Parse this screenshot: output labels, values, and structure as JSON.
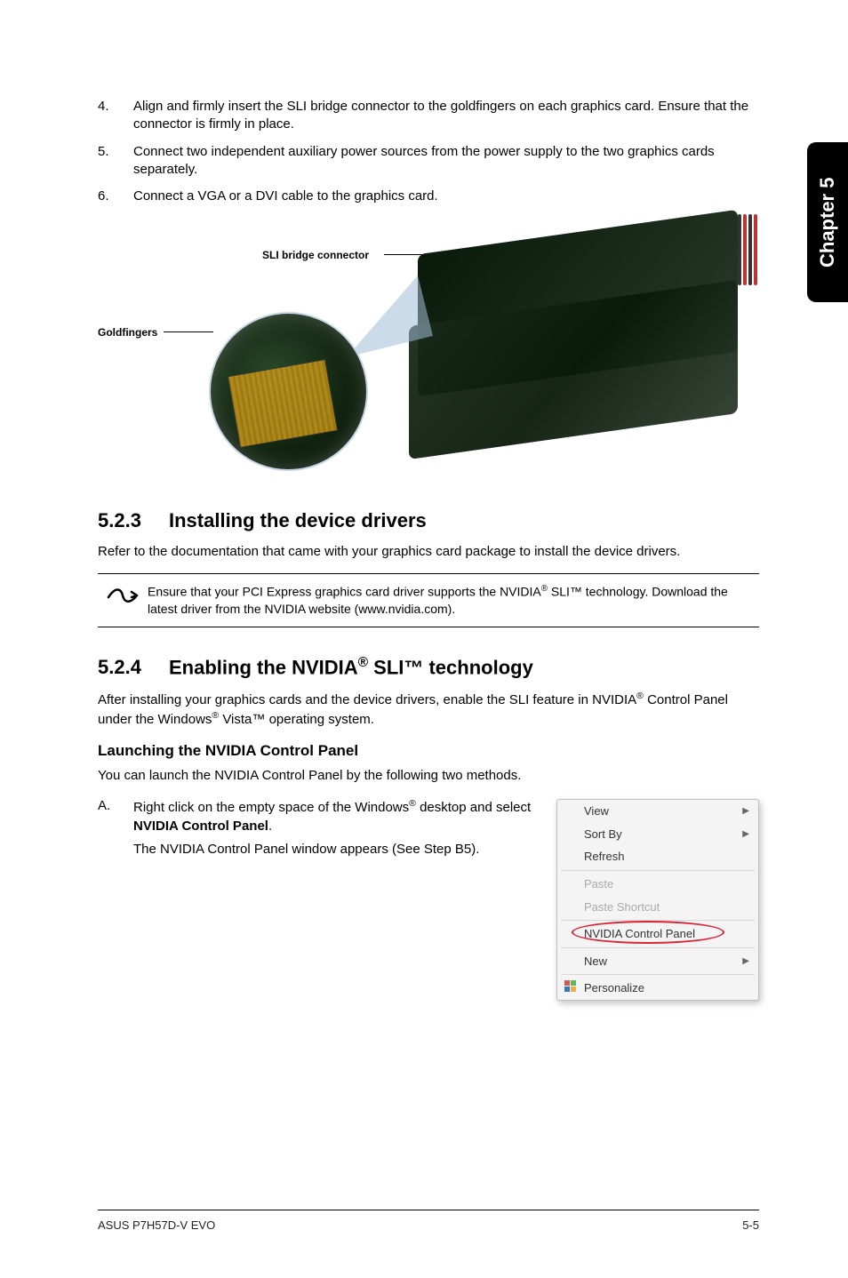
{
  "sidetab": "Chapter 5",
  "steps": [
    {
      "num": "4.",
      "text": "Align and firmly insert the SLI bridge connector to the goldfingers on each graphics card. Ensure that the connector is firmly in place."
    },
    {
      "num": "5.",
      "text": "Connect two independent auxiliary power sources from the power supply to the two graphics cards separately."
    },
    {
      "num": "6.",
      "text": "Connect a VGA or a DVI cable to the graphics card."
    }
  ],
  "figure": {
    "bridge_label": "SLI bridge connector",
    "gold_label": "Goldfingers"
  },
  "section_523": {
    "num": "5.2.3",
    "title": "Installing the device drivers",
    "body": "Refer to the documentation that came with your graphics card package to install the device drivers."
  },
  "note": {
    "pre": "Ensure that your PCI Express graphics card driver supports the NVIDIA",
    "sup": "®",
    "post": " SLI™ technology. Download the latest driver from the NVIDIA website (www.nvidia.com)."
  },
  "section_524": {
    "num": "5.2.4",
    "title_pre": "Enabling the NVIDIA",
    "title_sup": "®",
    "title_post": " SLI™ technology",
    "body_pre": "After installing your graphics cards and the device drivers, enable the SLI feature in NVIDIA",
    "body_sup1": "®",
    "body_mid": " Control Panel under the Windows",
    "body_sup2": "®",
    "body_post": " Vista™ operating system."
  },
  "launch": {
    "heading": "Launching the NVIDIA Control Panel",
    "intro": "You can launch the NVIDIA Control Panel by the following two methods.",
    "item_mark": "A.",
    "item_line1_pre": "Right click on the empty space of the Windows",
    "item_line1_sup": "®",
    "item_line1_post": " desktop and select ",
    "item_line1_bold": "NVIDIA Control Panel",
    "item_line1_end": ".",
    "item_line2": "The NVIDIA Control Panel window appears (See Step B5)."
  },
  "menu": {
    "view": "View",
    "sortby": "Sort By",
    "refresh": "Refresh",
    "paste": "Paste",
    "paste_shortcut": "Paste Shortcut",
    "nvidia": "NVIDIA Control Panel",
    "new": "New",
    "personalize": "Personalize"
  },
  "footer": {
    "left": "ASUS P7H57D-V EVO",
    "right": "5-5"
  }
}
